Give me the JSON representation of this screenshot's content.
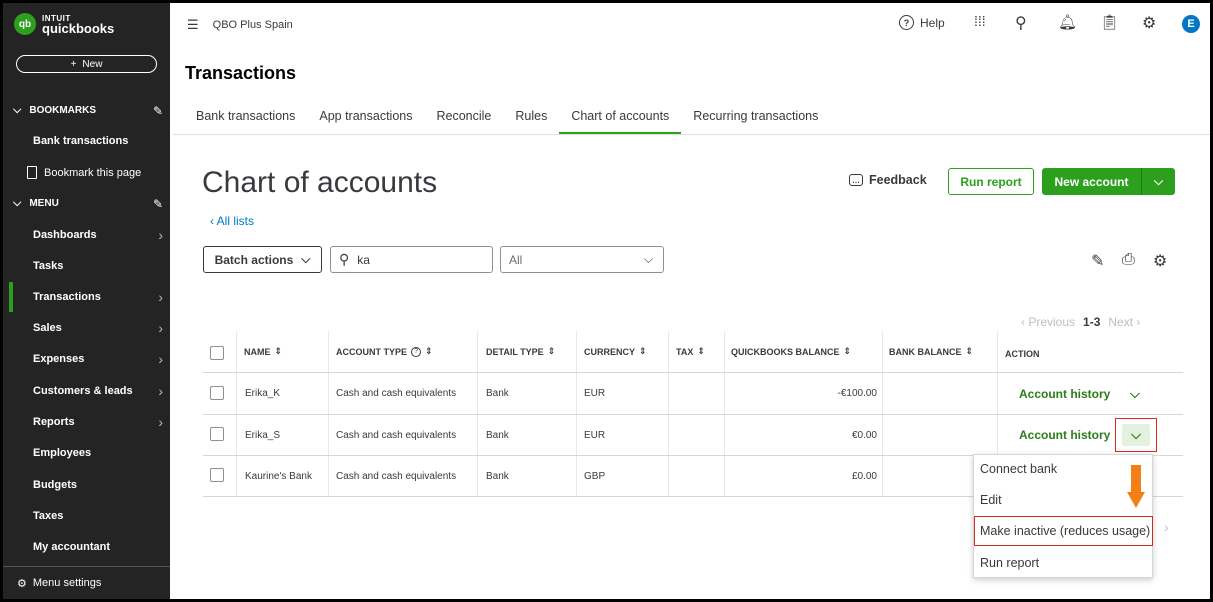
{
  "sidebar": {
    "logo_brand": "INTUIT",
    "logo_name": "quickbooks",
    "logo_mark": "qb",
    "new_button": "New",
    "bookmarks_label": "BOOKMARKS",
    "bookmark_items": [
      "Bank transactions",
      "Bookmark this page"
    ],
    "menu_label": "MENU",
    "menu_items": [
      {
        "label": "Dashboards",
        "has_arrow": true
      },
      {
        "label": "Tasks",
        "has_arrow": false
      },
      {
        "label": "Transactions",
        "has_arrow": true,
        "active": true
      },
      {
        "label": "Sales",
        "has_arrow": true
      },
      {
        "label": "Expenses",
        "has_arrow": true
      },
      {
        "label": "Customers & leads",
        "has_arrow": true
      },
      {
        "label": "Reports",
        "has_arrow": true
      },
      {
        "label": "Employees",
        "has_arrow": false
      },
      {
        "label": "Budgets",
        "has_arrow": false
      },
      {
        "label": "Taxes",
        "has_arrow": false
      },
      {
        "label": "My accountant",
        "has_arrow": false
      }
    ],
    "menu_settings": "Menu settings"
  },
  "topbar": {
    "company": "QBO Plus Spain",
    "help": "Help",
    "avatar_initial": "E"
  },
  "page_heading": "Transactions",
  "tabs": [
    {
      "label": "Bank transactions",
      "active": false
    },
    {
      "label": "App transactions",
      "active": false
    },
    {
      "label": "Reconcile",
      "active": false
    },
    {
      "label": "Rules",
      "active": false
    },
    {
      "label": "Chart of accounts",
      "active": true
    },
    {
      "label": "Recurring transactions",
      "active": false
    }
  ],
  "coa": {
    "title": "Chart of accounts",
    "all_lists": "All lists",
    "feedback": "Feedback",
    "run_report": "Run report",
    "new_account": "New account",
    "batch_actions": "Batch actions",
    "search_value": "ka",
    "filter_value": "All"
  },
  "pager": {
    "previous": "Previous",
    "range": "1-3",
    "next": "Next"
  },
  "table": {
    "headers": [
      "NAME",
      "ACCOUNT TYPE",
      "DETAIL TYPE",
      "CURRENCY",
      "TAX",
      "QUICKBOOKS BALANCE",
      "BANK BALANCE",
      "ACTION"
    ],
    "rows": [
      {
        "name": "Erika_K",
        "account_type": "Cash and cash equivalents",
        "detail_type": "Bank",
        "currency": "EUR",
        "tax": "",
        "qb_balance": "-€100.00",
        "bank_balance": "",
        "action": "Account history"
      },
      {
        "name": "Erika_S",
        "account_type": "Cash and cash equivalents",
        "detail_type": "Bank",
        "currency": "EUR",
        "tax": "",
        "qb_balance": "€0.00",
        "bank_balance": "",
        "action": "Account history"
      },
      {
        "name": "Kaurine's Bank",
        "account_type": "Cash and cash equivalents",
        "detail_type": "Bank",
        "currency": "GBP",
        "tax": "",
        "qb_balance": "£0.00",
        "bank_balance": "",
        "action": ""
      }
    ]
  },
  "dropdown": {
    "items": [
      "Connect bank",
      "Edit",
      "Make inactive (reduces usage)",
      "Run report"
    ],
    "highlighted": "Make inactive (reduces usage)"
  },
  "colors": {
    "brand_green": "#2ca01c",
    "link_blue": "#0077c5",
    "highlight_red": "#d52b1e",
    "arrow_orange": "#f57f17",
    "sidebar_bg": "#242424"
  }
}
